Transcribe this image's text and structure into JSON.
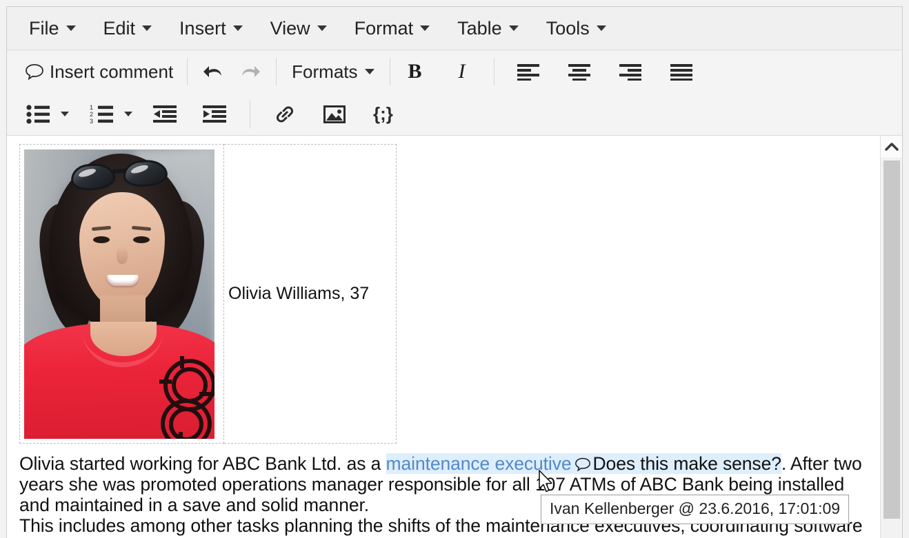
{
  "app": {
    "type": "rich-text-editor"
  },
  "menubar": {
    "items": [
      {
        "label": "File",
        "name": "menu-file"
      },
      {
        "label": "Edit",
        "name": "menu-edit"
      },
      {
        "label": "Insert",
        "name": "menu-insert"
      },
      {
        "label": "View",
        "name": "menu-view"
      },
      {
        "label": "Format",
        "name": "menu-format"
      },
      {
        "label": "Table",
        "name": "menu-table"
      },
      {
        "label": "Tools",
        "name": "menu-tools"
      }
    ]
  },
  "toolbar_row1": {
    "insert_comment_label": "Insert comment",
    "insert_comment_icon": "comment-bubble-icon",
    "undo_icon": "undo-arrow-icon",
    "redo_icon": "redo-arrow-icon",
    "formats_label": "Formats",
    "bold_label": "B",
    "italic_label": "I",
    "align_left_icon": "align-left-icon",
    "align_center_icon": "align-center-icon",
    "align_right_icon": "align-right-icon",
    "align_justify_icon": "align-justify-icon"
  },
  "toolbar_row2": {
    "bullet_list_icon": "bullet-list-icon",
    "numbered_list_icon": "numbered-list-icon",
    "outdent_icon": "outdent-icon",
    "indent_icon": "indent-icon",
    "link_icon": "link-icon",
    "image_icon": "image-icon",
    "code_label": "{;}"
  },
  "document": {
    "table": {
      "photo_alt": "portrait-photo",
      "name_cell": "Olivia Williams, 37"
    },
    "paragraph1": {
      "before": "Olivia started working for ABC Bank Ltd. as a ",
      "comment_target": "maintenance executive",
      "comment_text": "Does this make sense?",
      "after": ". After two years she was promoted operations manager responsible for all 107 ATMs of ABC Bank being installed and maintained in a save and solid manner."
    },
    "paragraph2": "This includes among other tasks planning the shifts of the maintenance executives, coordinating software"
  },
  "tooltip": {
    "text": "Ivan Kellenberger @ 23.6.2016, 17:01:09"
  },
  "scrollbar": {
    "up_arrow_icon": "chevron-up-icon"
  },
  "colors": {
    "comment_highlight": "#ddeefc",
    "comment_link": "#5588c9",
    "toolbar_bg": "#f4f4f4",
    "menubar_bg": "#f0f0f0"
  }
}
